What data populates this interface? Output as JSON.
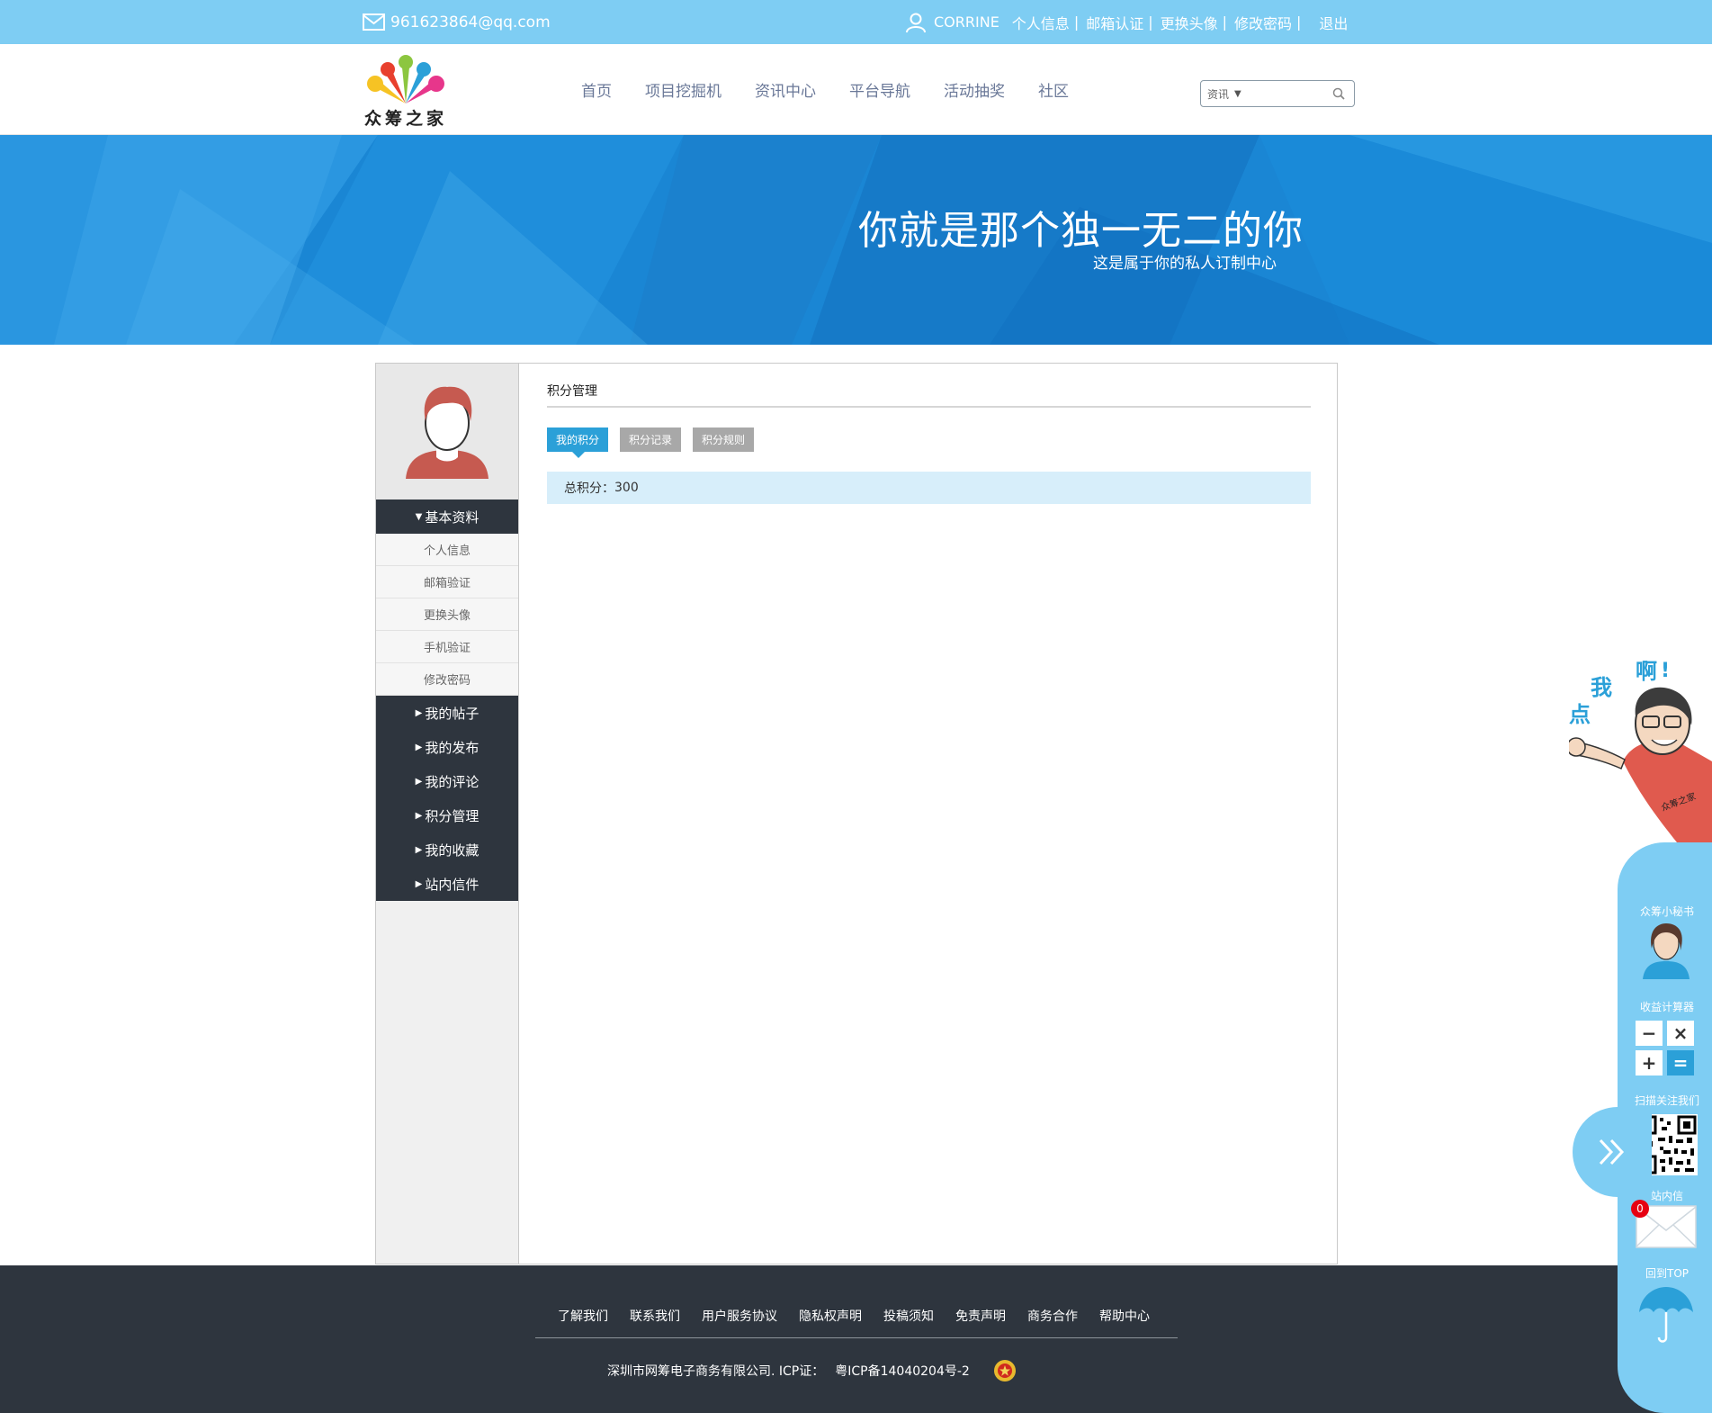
{
  "topbar": {
    "email": "961623864@qq.com",
    "username": "CORRINE",
    "links": [
      "个人信息",
      "邮箱认证",
      "更换头像",
      "修改密码"
    ],
    "separator": "|",
    "logout": "退出"
  },
  "header": {
    "logo_text": "众筹之家",
    "nav": [
      "首页",
      "项目挖掘机",
      "资讯中心",
      "平台导航",
      "活动抽奖",
      "社区"
    ],
    "search": {
      "category": "资讯",
      "value": "",
      "placeholder": ""
    }
  },
  "banner": {
    "title": "你就是那个独一无二的你",
    "subtitle": "这是属于你的私人订制中心"
  },
  "sidebar": {
    "basic_group": "基本资料",
    "basic_items": [
      "个人信息",
      "邮箱验证",
      "更换头像",
      "手机验证",
      "修改密码"
    ],
    "groups": [
      "我的帖子",
      "我的发布",
      "我的评论",
      "积分管理",
      "我的收藏",
      "站内信件"
    ]
  },
  "main": {
    "title": "积分管理",
    "tabs": [
      "我的积分",
      "积分记录",
      "积分规则"
    ],
    "active_tab": 0,
    "score_label": "总积分：",
    "score_value": "300"
  },
  "footer": {
    "links": [
      "了解我们",
      "联系我们",
      "用户服务协议",
      "隐私权声明",
      "投稿须知",
      "免责声明",
      "商务合作",
      "帮助中心"
    ],
    "copyright": "深圳市网筹电子商务有限公司. ICP证：",
    "icp": "粤ICP备14040204号-2"
  },
  "widget": {
    "mascot_words": [
      "我",
      "点",
      "啊",
      "!"
    ],
    "shirt_text": "众筹之家",
    "secretary": "众筹小秘书",
    "calculator": "收益计算器",
    "calc_keys": [
      "−",
      "×",
      "+",
      "="
    ],
    "scan": "扫描关注我们",
    "inbox": "站内信",
    "inbox_count": "0",
    "back_top": "回到TOP"
  },
  "colors": {
    "topbar": "#7ecdf3",
    "accent": "#2ba0d8",
    "sidebar_dark": "#2e353e",
    "footer": "#2e353e",
    "score_bg": "#d7eefa"
  }
}
